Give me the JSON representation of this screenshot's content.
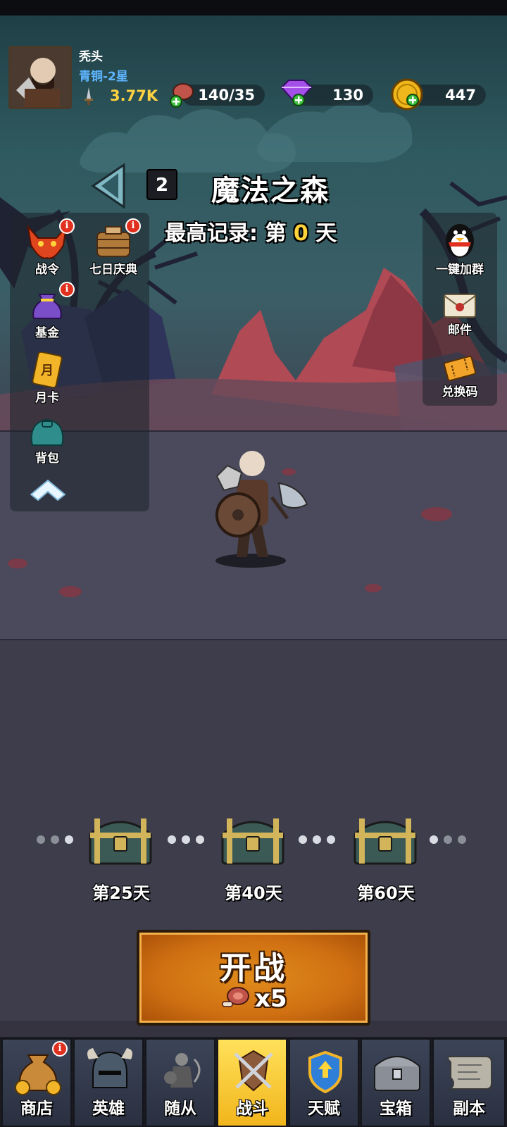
{
  "player": {
    "name": "秃头",
    "rank": "青铜-2星",
    "power": "3.77K"
  },
  "resources": {
    "stamina": "140/35",
    "gems": "130",
    "coins": "447"
  },
  "stage": {
    "number": "2",
    "name": "魔法之森",
    "record_prefix": "最高记录: 第",
    "record_value": "0",
    "record_suffix": "天"
  },
  "left_menu": [
    {
      "label": "战令",
      "badge": "i"
    },
    {
      "label": "七日庆典",
      "badge": "i"
    },
    {
      "label": "基金",
      "badge": "i"
    },
    {
      "label": "月卡",
      "card_char": "月"
    },
    {
      "label": "背包"
    }
  ],
  "right_menu": [
    {
      "label": "一键加群"
    },
    {
      "label": "邮件"
    },
    {
      "label": "兑换码"
    }
  ],
  "chests": [
    {
      "label": "第25天"
    },
    {
      "label": "第40天"
    },
    {
      "label": "第60天"
    }
  ],
  "start_button": {
    "label": "开战",
    "cost": "x5"
  },
  "nav": [
    {
      "label": "商店",
      "badge": "i",
      "icon": "coin-bag-icon"
    },
    {
      "label": "英雄",
      "icon": "helmet-icon"
    },
    {
      "label": "随从",
      "icon": "follower-icon"
    },
    {
      "label": "战斗",
      "icon": "crossed-swords-icon",
      "active": true
    },
    {
      "label": "天赋",
      "icon": "talent-shield-icon"
    },
    {
      "label": "宝箱",
      "icon": "chest-icon"
    },
    {
      "label": "副本",
      "icon": "scroll-icon"
    }
  ],
  "colors": {
    "accent": "#ffd43b",
    "rank": "#5fb6ff",
    "start": "#d9781a",
    "nav_active": "#f7c530"
  }
}
